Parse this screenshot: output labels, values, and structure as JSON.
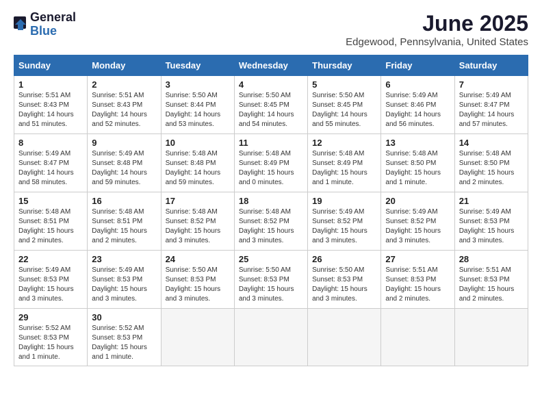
{
  "logo": {
    "general": "General",
    "blue": "Blue"
  },
  "title": {
    "month": "June 2025",
    "location": "Edgewood, Pennsylvania, United States"
  },
  "headers": [
    "Sunday",
    "Monday",
    "Tuesday",
    "Wednesday",
    "Thursday",
    "Friday",
    "Saturday"
  ],
  "weeks": [
    [
      {
        "day": "1",
        "info": "Sunrise: 5:51 AM\nSunset: 8:43 PM\nDaylight: 14 hours\nand 51 minutes."
      },
      {
        "day": "2",
        "info": "Sunrise: 5:51 AM\nSunset: 8:43 PM\nDaylight: 14 hours\nand 52 minutes."
      },
      {
        "day": "3",
        "info": "Sunrise: 5:50 AM\nSunset: 8:44 PM\nDaylight: 14 hours\nand 53 minutes."
      },
      {
        "day": "4",
        "info": "Sunrise: 5:50 AM\nSunset: 8:45 PM\nDaylight: 14 hours\nand 54 minutes."
      },
      {
        "day": "5",
        "info": "Sunrise: 5:50 AM\nSunset: 8:45 PM\nDaylight: 14 hours\nand 55 minutes."
      },
      {
        "day": "6",
        "info": "Sunrise: 5:49 AM\nSunset: 8:46 PM\nDaylight: 14 hours\nand 56 minutes."
      },
      {
        "day": "7",
        "info": "Sunrise: 5:49 AM\nSunset: 8:47 PM\nDaylight: 14 hours\nand 57 minutes."
      }
    ],
    [
      {
        "day": "8",
        "info": "Sunrise: 5:49 AM\nSunset: 8:47 PM\nDaylight: 14 hours\nand 58 minutes."
      },
      {
        "day": "9",
        "info": "Sunrise: 5:49 AM\nSunset: 8:48 PM\nDaylight: 14 hours\nand 59 minutes."
      },
      {
        "day": "10",
        "info": "Sunrise: 5:48 AM\nSunset: 8:48 PM\nDaylight: 14 hours\nand 59 minutes."
      },
      {
        "day": "11",
        "info": "Sunrise: 5:48 AM\nSunset: 8:49 PM\nDaylight: 15 hours\nand 0 minutes."
      },
      {
        "day": "12",
        "info": "Sunrise: 5:48 AM\nSunset: 8:49 PM\nDaylight: 15 hours\nand 1 minute."
      },
      {
        "day": "13",
        "info": "Sunrise: 5:48 AM\nSunset: 8:50 PM\nDaylight: 15 hours\nand 1 minute."
      },
      {
        "day": "14",
        "info": "Sunrise: 5:48 AM\nSunset: 8:50 PM\nDaylight: 15 hours\nand 2 minutes."
      }
    ],
    [
      {
        "day": "15",
        "info": "Sunrise: 5:48 AM\nSunset: 8:51 PM\nDaylight: 15 hours\nand 2 minutes."
      },
      {
        "day": "16",
        "info": "Sunrise: 5:48 AM\nSunset: 8:51 PM\nDaylight: 15 hours\nand 2 minutes."
      },
      {
        "day": "17",
        "info": "Sunrise: 5:48 AM\nSunset: 8:52 PM\nDaylight: 15 hours\nand 3 minutes."
      },
      {
        "day": "18",
        "info": "Sunrise: 5:48 AM\nSunset: 8:52 PM\nDaylight: 15 hours\nand 3 minutes."
      },
      {
        "day": "19",
        "info": "Sunrise: 5:49 AM\nSunset: 8:52 PM\nDaylight: 15 hours\nand 3 minutes."
      },
      {
        "day": "20",
        "info": "Sunrise: 5:49 AM\nSunset: 8:52 PM\nDaylight: 15 hours\nand 3 minutes."
      },
      {
        "day": "21",
        "info": "Sunrise: 5:49 AM\nSunset: 8:53 PM\nDaylight: 15 hours\nand 3 minutes."
      }
    ],
    [
      {
        "day": "22",
        "info": "Sunrise: 5:49 AM\nSunset: 8:53 PM\nDaylight: 15 hours\nand 3 minutes."
      },
      {
        "day": "23",
        "info": "Sunrise: 5:49 AM\nSunset: 8:53 PM\nDaylight: 15 hours\nand 3 minutes."
      },
      {
        "day": "24",
        "info": "Sunrise: 5:50 AM\nSunset: 8:53 PM\nDaylight: 15 hours\nand 3 minutes."
      },
      {
        "day": "25",
        "info": "Sunrise: 5:50 AM\nSunset: 8:53 PM\nDaylight: 15 hours\nand 3 minutes."
      },
      {
        "day": "26",
        "info": "Sunrise: 5:50 AM\nSunset: 8:53 PM\nDaylight: 15 hours\nand 3 minutes."
      },
      {
        "day": "27",
        "info": "Sunrise: 5:51 AM\nSunset: 8:53 PM\nDaylight: 15 hours\nand 2 minutes."
      },
      {
        "day": "28",
        "info": "Sunrise: 5:51 AM\nSunset: 8:53 PM\nDaylight: 15 hours\nand 2 minutes."
      }
    ],
    [
      {
        "day": "29",
        "info": "Sunrise: 5:52 AM\nSunset: 8:53 PM\nDaylight: 15 hours\nand 1 minute."
      },
      {
        "day": "30",
        "info": "Sunrise: 5:52 AM\nSunset: 8:53 PM\nDaylight: 15 hours\nand 1 minute."
      },
      {
        "day": "",
        "info": ""
      },
      {
        "day": "",
        "info": ""
      },
      {
        "day": "",
        "info": ""
      },
      {
        "day": "",
        "info": ""
      },
      {
        "day": "",
        "info": ""
      }
    ]
  ]
}
